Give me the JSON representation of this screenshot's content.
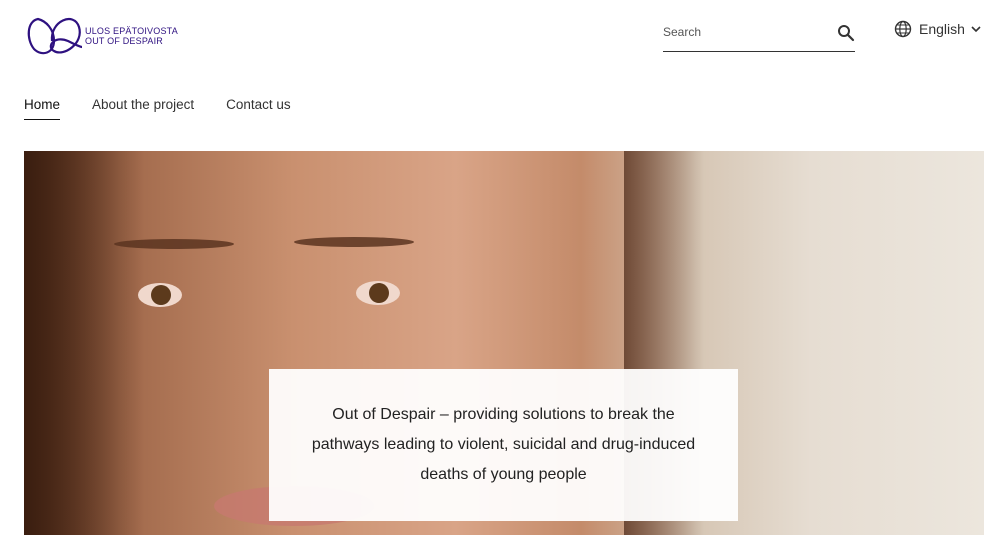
{
  "header": {
    "logo": {
      "line1": "ULOS EPÄTOIVOSTA",
      "line2": "OUT OF DESPAIR",
      "color": "#2e1180"
    },
    "search": {
      "placeholder": "Search",
      "value": "",
      "icon": "search-icon"
    },
    "language": {
      "label": "English",
      "icon": "globe-icon"
    }
  },
  "nav": {
    "tabs": [
      {
        "label": "Home",
        "active": true
      },
      {
        "label": "About the project",
        "active": false
      },
      {
        "label": "Contact us",
        "active": false
      }
    ]
  },
  "hero": {
    "caption": "Out of Despair – providing solutions to break the pathways leading to violent, suicidal and drug-induced deaths of young people"
  }
}
